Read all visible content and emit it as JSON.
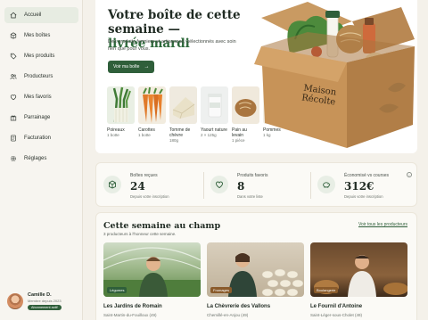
{
  "sidebar": {
    "items": [
      {
        "label": "Accueil",
        "icon": "home-icon",
        "active": true
      },
      {
        "label": "Mes boîtes",
        "icon": "box-icon",
        "active": false
      },
      {
        "label": "Mes produits",
        "icon": "tag-icon",
        "active": false
      },
      {
        "label": "Producteurs",
        "icon": "users-icon",
        "active": false
      },
      {
        "label": "Mes favoris",
        "icon": "heart-icon",
        "active": false
      },
      {
        "label": "Parrainage",
        "icon": "gift-icon",
        "active": false
      },
      {
        "label": "Facturation",
        "icon": "invoice-icon",
        "active": false
      },
      {
        "label": "Réglages",
        "icon": "gear-icon",
        "active": false
      }
    ],
    "user": {
      "name": "Camille D.",
      "since": "Membre depuis 2023",
      "badge": "Abonnement actif"
    }
  },
  "hero": {
    "title": "Votre boîte de cette semaine —",
    "title_accent": "livrée mardi",
    "description": "Des produits fermiers et artisanaux, sélectionnés avec soin rien que pour vous.",
    "cta": "Voir ma boîte",
    "box_brand": "Maison Récolte",
    "products": [
      {
        "name": "Poireaux",
        "qty": "1 botte"
      },
      {
        "name": "Carottes",
        "qty": "1 botte"
      },
      {
        "name": "Tomme de chèvre",
        "qty": "180g"
      },
      {
        "name": "Yaourt nature",
        "qty": "2 × 125g"
      },
      {
        "name": "Pain au levain",
        "qty": "1 pièce"
      },
      {
        "name": "Pommes",
        "qty": "1 kg"
      }
    ]
  },
  "stats": [
    {
      "label": "Boîtes reçues",
      "value": "24",
      "sub": "Depuis votre inscription",
      "icon": "box-icon"
    },
    {
      "label": "Produits favoris",
      "value": "8",
      "sub": "Dans votre liste",
      "icon": "heart-icon"
    },
    {
      "label": "Économisé vs courses",
      "value": "312€",
      "sub": "Depuis votre inscription",
      "icon": "piggy-bank-icon"
    }
  ],
  "farm": {
    "title": "Cette semaine au champ",
    "subtitle": "3 producteurs à l'honneur cette semaine.",
    "link": "Voir tous les producteurs",
    "producers": [
      {
        "tag": "Légumes",
        "name": "Les Jardins de Romain",
        "location": "Saint-Martin-du-Fouilloux (49)"
      },
      {
        "tag": "Fromages",
        "name": "La Chèvrerie des Vallons",
        "location": "Chemillé-en-Anjou (49)"
      },
      {
        "tag": "Boulangerie",
        "name": "Le Fournil d'Antoine",
        "location": "Saint-Léger-sous-Cholet (49)"
      }
    ]
  },
  "colors": {
    "accent": "#2f5f3a",
    "background": "#f4f1ea",
    "card": "#fbfaf6"
  }
}
